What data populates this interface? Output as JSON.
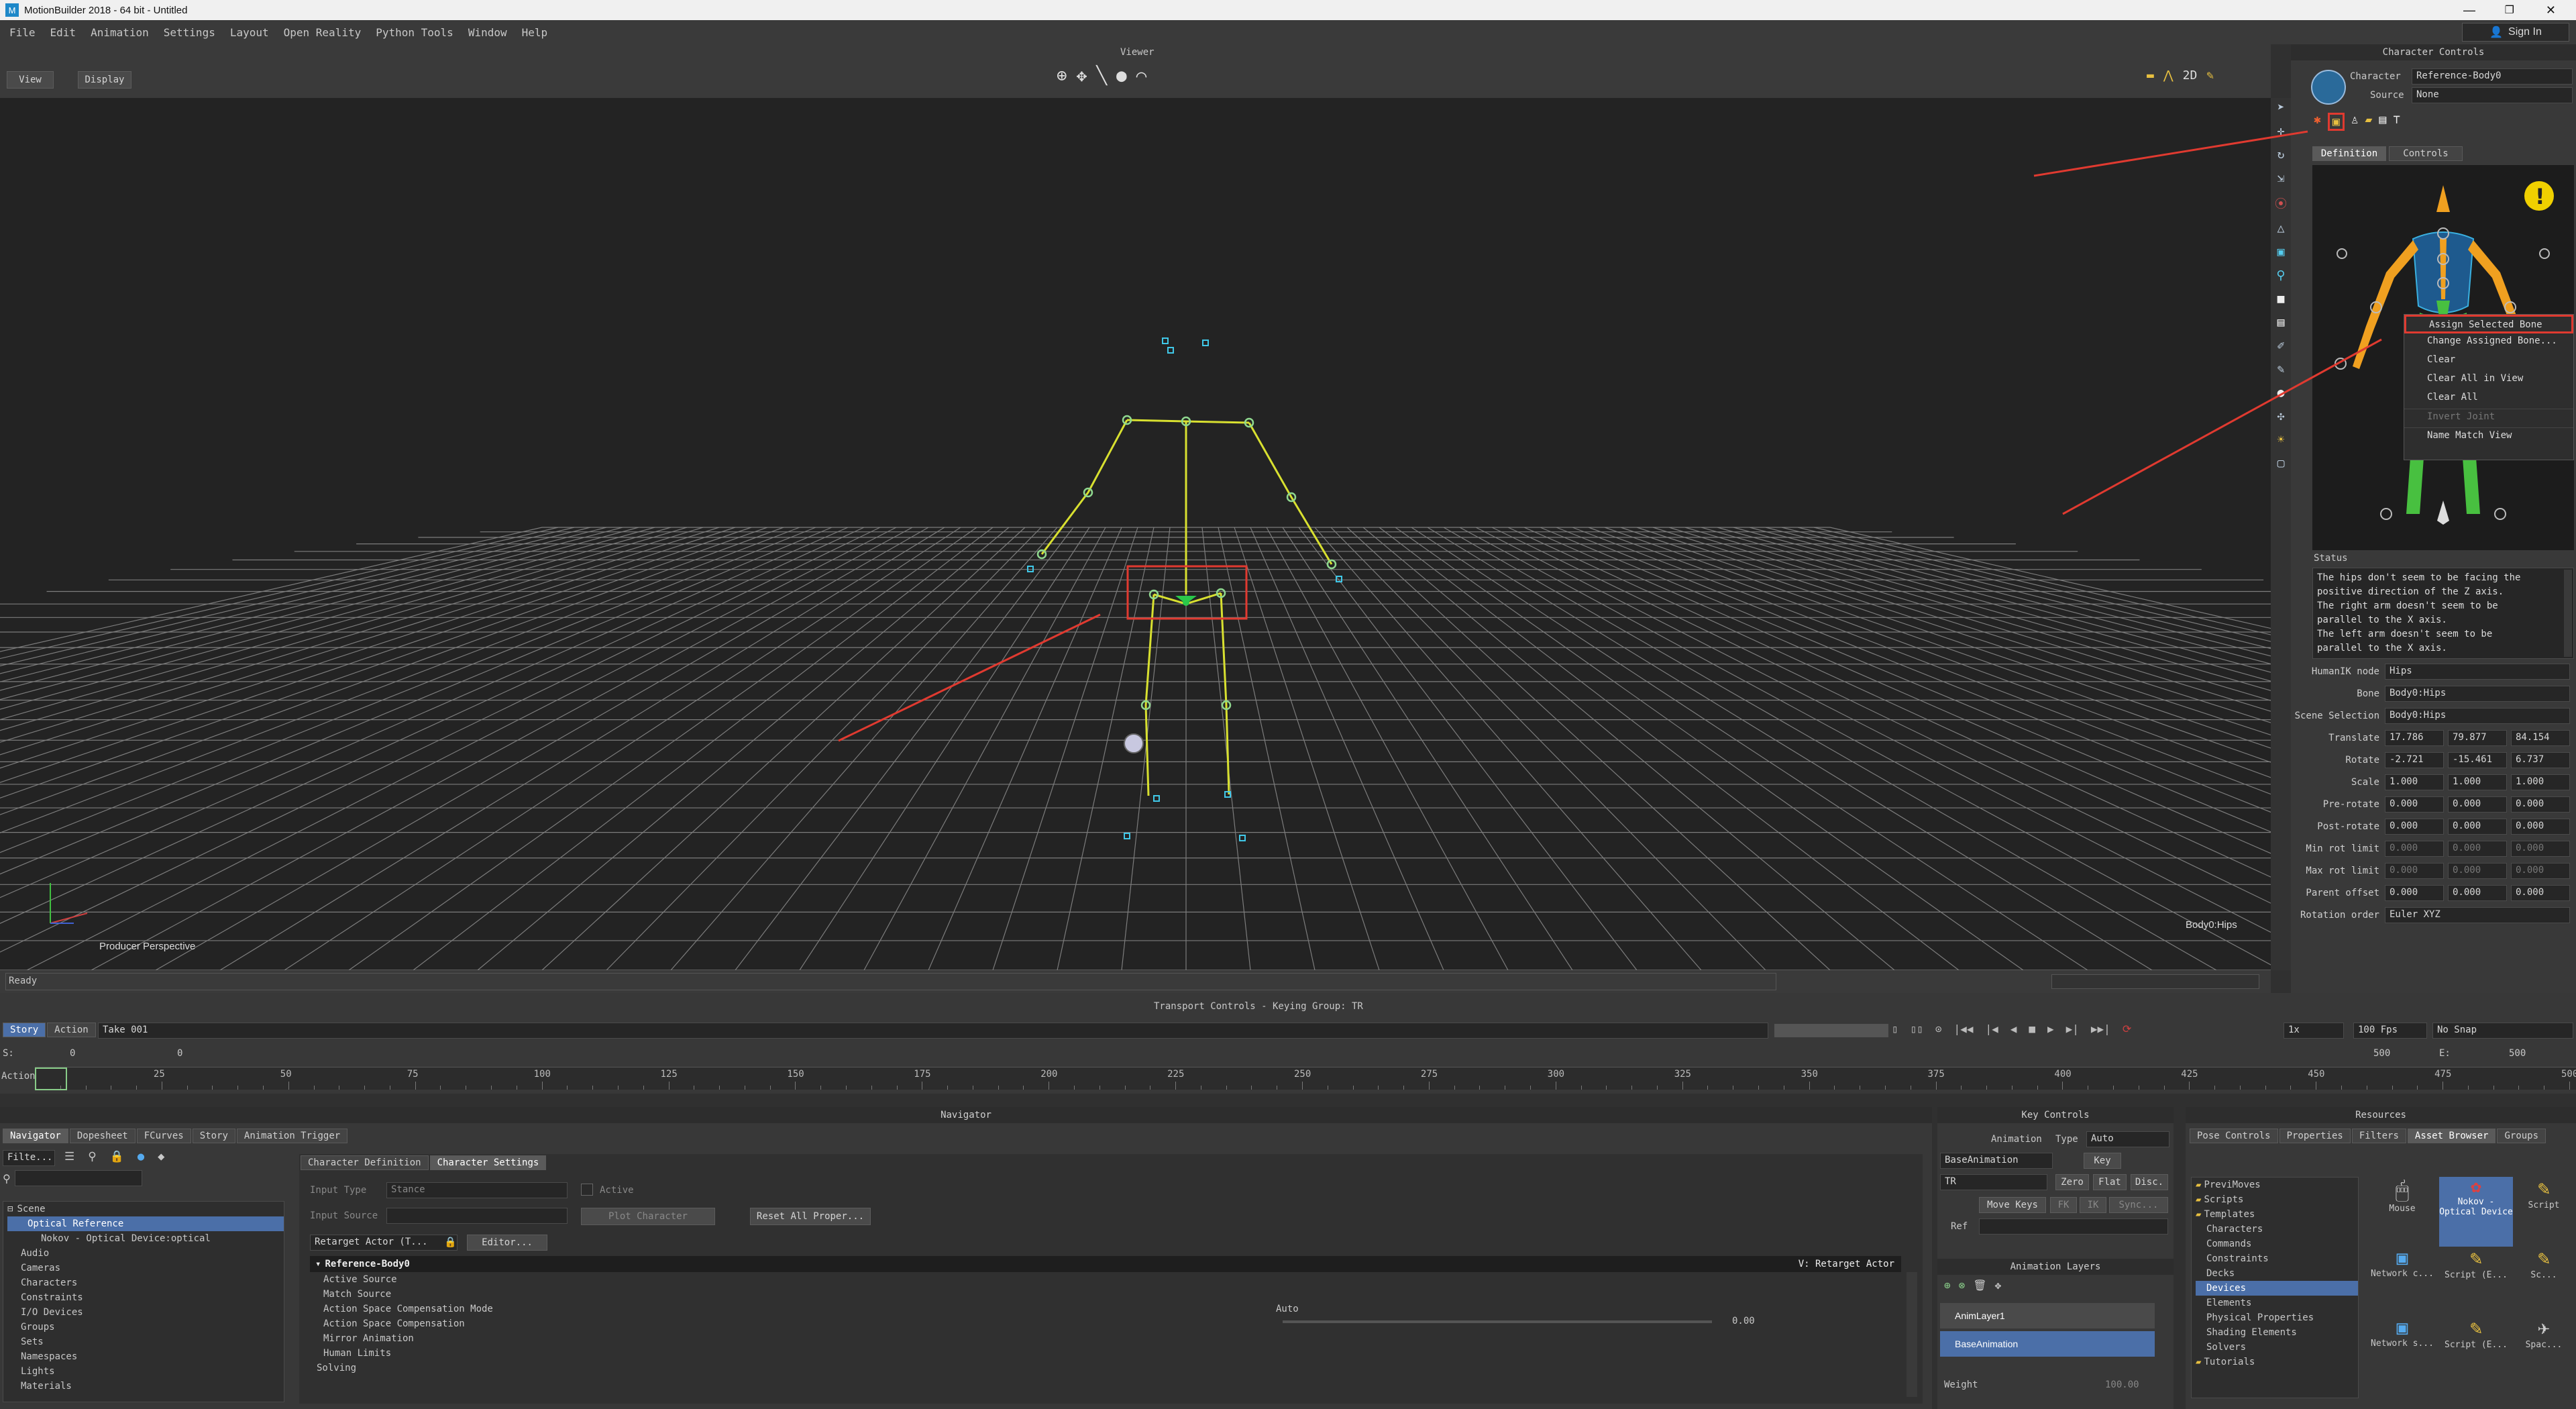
{
  "window": {
    "title": "MotionBuilder 2018 - 64 bit - Untitled",
    "sign_in": "Sign In"
  },
  "menu": [
    "File",
    "Edit",
    "Animation",
    "Settings",
    "Layout",
    "Open Reality",
    "Python Tools",
    "Window",
    "Help"
  ],
  "viewer": {
    "title": "Viewer",
    "view_btn": "View",
    "display_btn": "Display",
    "camera_label": "Producer Perspective",
    "hud_label": "Body0:Hips",
    "status": "Ready"
  },
  "character_controls": {
    "title": "Character Controls",
    "character_label": "Character",
    "character_value": "Reference-Body0",
    "source_label": "Source",
    "source_value": "None",
    "tabs": [
      "Definition",
      "Controls"
    ],
    "context_menu": [
      "Assign Selected Bone",
      "Change Assigned Bone...",
      "Clear",
      "Clear All in View",
      "Clear All",
      "Invert Joint",
      "Name Match View"
    ],
    "status_title": "Status",
    "status_text": [
      "The hips don't seem to be facing the",
      "positive direction of the Z axis.",
      "The right arm doesn't seem to be",
      "parallel to the X axis.",
      "The left arm doesn't seem to be",
      "parallel to the X axis."
    ],
    "fields": [
      {
        "label": "HumanIK node",
        "values": [
          "Hips"
        ]
      },
      {
        "label": "Bone",
        "values": [
          "Body0:Hips"
        ]
      },
      {
        "label": "Scene Selection",
        "values": [
          "Body0:Hips"
        ]
      },
      {
        "label": "Translate",
        "values": [
          "17.786",
          "79.877",
          "84.154"
        ]
      },
      {
        "label": "Rotate",
        "values": [
          "-2.721",
          "-15.461",
          "6.737"
        ]
      },
      {
        "label": "Scale",
        "values": [
          "1.000",
          "1.000",
          "1.000"
        ]
      },
      {
        "label": "Pre-rotate",
        "values": [
          "0.000",
          "0.000",
          "0.000"
        ]
      },
      {
        "label": "Post-rotate",
        "values": [
          "0.000",
          "0.000",
          "0.000"
        ]
      },
      {
        "label": "Min rot limit",
        "values": [
          "0.000",
          "0.000",
          "0.000"
        ]
      },
      {
        "label": "Max rot limit",
        "values": [
          "0.000",
          "0.000",
          "0.000"
        ]
      },
      {
        "label": "Parent offset",
        "values": [
          "0.000",
          "0.000",
          "0.000"
        ]
      },
      {
        "label": "Rotation order",
        "values": [
          "Euler XYZ"
        ]
      }
    ]
  },
  "transport": {
    "title": "Transport Controls  -  Keying Group: TR",
    "tabs": [
      "Story",
      "Action"
    ],
    "take": "Take 001",
    "speed": "1x",
    "fps": "100 Fps",
    "snap": "No Snap",
    "start_label": "S:",
    "start_value": "0",
    "current_value": "0",
    "end_label": "E:",
    "end_value": "500",
    "end_field": "500",
    "action_label": "Action",
    "ticks": [
      "25",
      "50",
      "75",
      "100",
      "125",
      "150",
      "175",
      "200",
      "225",
      "250",
      "275",
      "300",
      "325",
      "350",
      "375",
      "400",
      "425",
      "450",
      "475",
      "500"
    ]
  },
  "navigator": {
    "title": "Navigator",
    "tabs": [
      "Navigator",
      "Dopesheet",
      "FCurves",
      "Story",
      "Animation Trigger"
    ],
    "filter_label": "Filte...",
    "tree": [
      "Scene",
      "Optical Reference",
      "Nokov - Optical Device:optical",
      "Audio",
      "Cameras",
      "Characters",
      "Constraints",
      "I/O Devices",
      "Groups",
      "Sets",
      "Namespaces",
      "Lights",
      "Materials"
    ],
    "sub_tabs": [
      "Character Definition",
      "Character Settings"
    ],
    "input_type_label": "Input Type",
    "input_type_value": "Stance",
    "input_source_label": "Input Source",
    "active_label": "Active",
    "plot_character": "Plot Character",
    "reset_props": "Reset All Proper...",
    "retarget_label": "Retarget Actor (T...",
    "editor_btn": "Editor...",
    "props_header": "Reference-Body0",
    "props_header_right": "V: Retarget Actor",
    "props": [
      "Active Source",
      "Match Source",
      "Action Space Compensation Mode",
      "Action Space Compensation",
      "Mirror Animation",
      "Human Limits",
      "Solving"
    ],
    "auto_value": "Auto",
    "comp_value": "0.00"
  },
  "key_controls": {
    "title": "Key Controls",
    "animation_label": "Animation",
    "type_label": "Type",
    "type_value": "Auto",
    "layer_value": "BaseAnimation",
    "key_btn": "Key",
    "tr_value": "TR",
    "zero_btn": "Zero",
    "flat_btn": "Flat",
    "disc_btn": "Disc.",
    "move_keys": "Move Keys",
    "fk_btn": "FK",
    "ik_btn": "IK",
    "sync_btn": "Sync...",
    "ref_label": "Ref",
    "layers_title": "Animation Layers",
    "layers": [
      "AnimLayer1",
      "BaseAnimation"
    ],
    "weight_label": "Weight",
    "weight_value": "100.00"
  },
  "resources": {
    "title": "Resources",
    "tabs": [
      "Pose Controls",
      "Properties",
      "Filters",
      "Asset Browser",
      "Groups"
    ],
    "tree": [
      "PreviMoves",
      "Scripts",
      "Templates",
      "Characters",
      "Commands",
      "Constraints",
      "Decks",
      "Devices",
      "Elements",
      "Physical Properties",
      "Shading Elements",
      "Solvers",
      "Tutorials"
    ],
    "assets": [
      "Mouse",
      "Nokov - Optical Device",
      "Script",
      "Network c...",
      "Script (E...",
      "Sc...",
      "Network s...",
      "Script (E...",
      "Spac..."
    ]
  },
  "colors": {
    "accent": "#e04a3a",
    "highlight": "#4b6fa8",
    "skeleton": "#d8e030",
    "grid": "#9a9a9a"
  }
}
